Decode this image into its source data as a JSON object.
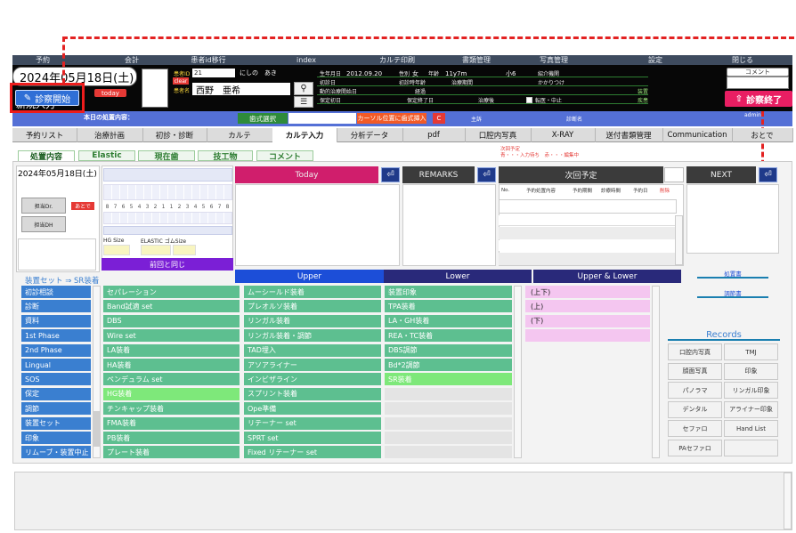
{
  "top_menu": [
    "予約",
    "会計",
    "患者id移行",
    "index",
    "カルテ印刷",
    "書類管理",
    "写真管理",
    "設定",
    "閉じる"
  ],
  "header": {
    "date": "2024年05月18日(土)",
    "today_label": "today",
    "start_button": "診察開始",
    "new_entry": "新規入力",
    "today_treatment_label": "本日の処置内容：",
    "patient_id_label": "患者ID",
    "patient_id": "21",
    "clear_label": "clear",
    "patient_name_label": "患者名",
    "patient_kana": "にしの　あき",
    "patient_name": "西野　亜希",
    "birth_label": "生年月日",
    "birth_date": "2012.09.20",
    "sex_label": "性別",
    "sex": "女",
    "age_label": "年齢",
    "age": "11y7m",
    "grade": "小6",
    "referral_label": "紹介機関",
    "first_visit_label": "初診日",
    "first_visit_age_label": "初診時年齢",
    "treatment_period_label": "治療期間",
    "family_doctor_label": "かかりつけ",
    "active_start_label": "動的治療開始日",
    "elapsed_label": "経過",
    "device_label": "装置",
    "retention_start_label": "保定初日",
    "retention_end_label": "保定終了日",
    "after_treatment_label": "治療後",
    "stop_label": "転医・中止",
    "diagnosis_label": "疾患",
    "main_complaint_label": "主訴",
    "diagnosis_name_label": "診断名",
    "tooth_select_button": "歯式選択",
    "cursor_insert_button": "カーソル位置に歯式挿入",
    "c_button": "C",
    "comment_label": "コメント",
    "end_button": "診察終了",
    "admin": "admin"
  },
  "tabs": [
    {
      "label": "予約リスト",
      "active": false
    },
    {
      "label": "治療計画",
      "active": false
    },
    {
      "label": "初診・診断",
      "active": false
    },
    {
      "label": "カルテ",
      "active": false
    },
    {
      "label": "カルテ入力",
      "active": true
    },
    {
      "label": "分析データ",
      "active": false
    },
    {
      "label": "pdf",
      "active": false
    },
    {
      "label": "口腔内写真",
      "active": false
    },
    {
      "label": "X-RAY",
      "active": false
    },
    {
      "label": "送付書類管理",
      "active": false
    },
    {
      "label": "Communication",
      "active": false
    },
    {
      "label": "おとで",
      "active": false
    }
  ],
  "next_appointment_note": {
    "line1": "次回予定",
    "line2": "青・・・入力待ち　赤・・・編集中"
  },
  "subtabs": [
    "処置内容",
    "Elastic",
    "現在歯",
    "技工物",
    "コメント"
  ],
  "left_panel": {
    "date": "2024年05月18日(土)",
    "doctor_label": "担当Dr.",
    "atode": "あとで",
    "dh_label": "担当DH",
    "tooth_numbers": [
      "8",
      "7",
      "6",
      "5",
      "4",
      "3",
      "2",
      "1",
      "1",
      "2",
      "3",
      "4",
      "5",
      "6",
      "7",
      "8"
    ],
    "hg_size_label": "HG Size",
    "elastic_size_label": "ELASTIC ゴムSize",
    "same_as_before_button": "前回と同じ"
  },
  "today_button": "Today",
  "remarks_button": "REMARKS",
  "next_plan_button": "次回予定",
  "next_button": "NEXT",
  "enter_icon": "⏎",
  "appointment_table": {
    "columns": [
      "No.",
      "予約処置内容",
      "予約期間",
      "診療時間",
      "予約日",
      "削除"
    ]
  },
  "device_set_header": "装置セット ⇒ SR装着",
  "categories": [
    "初診相談",
    "診断",
    "資料",
    "1st Phase",
    "2nd Phase",
    "Lingual",
    "SOS",
    "保定",
    "調節",
    "装置セット",
    "印象",
    "リムーブ・装置中止"
  ],
  "column_headers": {
    "upper": "Upper",
    "lower": "Lower",
    "upper_lower": "Upper & Lower"
  },
  "col1_items": [
    {
      "label": "セパレーション",
      "hl": false
    },
    {
      "label": "Band試適 set",
      "hl": false
    },
    {
      "label": "DBS",
      "hl": false
    },
    {
      "label": "Wire set",
      "hl": false
    },
    {
      "label": "LA装着",
      "hl": false
    },
    {
      "label": "HA装着",
      "hl": false
    },
    {
      "label": "ペンデュラム set",
      "hl": false
    },
    {
      "label": "HG装着",
      "hl": true
    },
    {
      "label": "チンキャップ装着",
      "hl": false
    },
    {
      "label": "FMA装着",
      "hl": false
    },
    {
      "label": "PB装着",
      "hl": false
    },
    {
      "label": "プレート装着",
      "hl": false
    }
  ],
  "col2_items": [
    {
      "label": "ムーシールド装着",
      "hl": false
    },
    {
      "label": "プレオルソ装着",
      "hl": false
    },
    {
      "label": "リンガル装着",
      "hl": false
    },
    {
      "label": "リンガル装着・調節",
      "hl": false
    },
    {
      "label": "TAD埋入",
      "hl": false
    },
    {
      "label": "アソアライナー",
      "hl": false
    },
    {
      "label": "インビザライン",
      "hl": false
    },
    {
      "label": "スプリント装着",
      "hl": false
    },
    {
      "label": "Ope準備",
      "hl": false
    },
    {
      "label": "リテーナー set",
      "hl": false
    },
    {
      "label": "SPRT set",
      "hl": false
    },
    {
      "label": "Fixed リテーナー set",
      "hl": false
    }
  ],
  "col3_items": [
    {
      "label": "装置印象",
      "hl": false
    },
    {
      "label": "TPA装着",
      "hl": false
    },
    {
      "label": "LA・GH装着",
      "hl": false
    },
    {
      "label": "REA・TC装着",
      "hl": false
    },
    {
      "label": "DBS調節",
      "hl": false
    },
    {
      "label": "Bd*2調節",
      "hl": false
    },
    {
      "label": "SR装着",
      "hl": true
    }
  ],
  "col4_items": [
    "(上下)",
    "(上)",
    "(下)"
  ],
  "right_small_buttons": [
    "処置書",
    "調節書"
  ],
  "records": {
    "title": "Records",
    "buttons": [
      "口腔内写真",
      "TMJ",
      "顔面写真",
      "印象",
      "パノラマ",
      "リンガル印象",
      "デンタル",
      "アライナー印象",
      "セファロ",
      "Hand List",
      "PAセファロ",
      ""
    ]
  },
  "colors": {
    "accent_red": "#ee1c1c",
    "menu_bg": "#3e4b5e",
    "green_button": "#5dbf90",
    "blue_category": "#3a7fd0",
    "pink_item": "#f4c6f0"
  }
}
